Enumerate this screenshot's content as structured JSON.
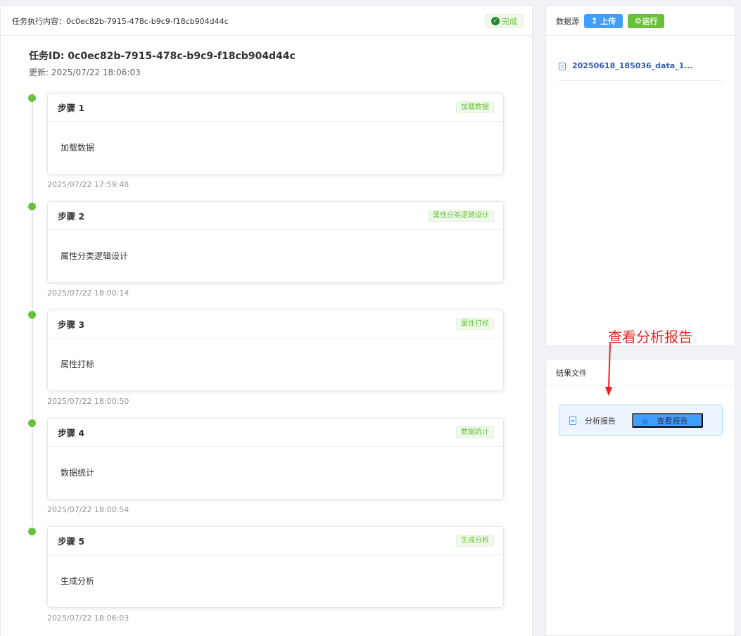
{
  "left": {
    "header_title": "任务执行内容：0c0ec82b-7915-478c-b9c9-f18cb904d44c",
    "status": "完成",
    "task_id": "任务ID: 0c0ec82b-7915-478c-b9c9-f18cb904d44c",
    "updated": "更新: 2025/07/22 18:06:03"
  },
  "steps": [
    {
      "title": "步骤 1",
      "tag": "加载数据",
      "content": "加载数据",
      "time": "2025/07/22 17:59:48"
    },
    {
      "title": "步骤 2",
      "tag": "属性分类逻辑设计",
      "content": "属性分类逻辑设计",
      "time": "2025/07/22 18:00:14"
    },
    {
      "title": "步骤 3",
      "tag": "属性打标",
      "content": "属性打标",
      "time": "2025/07/22 18:00:50"
    },
    {
      "title": "步骤 4",
      "tag": "数据统计",
      "content": "数据统计",
      "time": "2025/07/22 18:00:54"
    },
    {
      "title": "步骤 5",
      "tag": "生成分析",
      "content": "生成分析",
      "time": "2025/07/22 18:06:03"
    }
  ],
  "datasource": {
    "label": "数据源",
    "upload_label": "上传",
    "upload_icon": "↥",
    "run_label": "运行",
    "run_icon": "⊙",
    "file_name": "20250618_185036_data_1..."
  },
  "results": {
    "label": "结果文件",
    "report_name": "分析报告",
    "view_label": "查看报告"
  },
  "annotation": {
    "text": "查看分析报告"
  },
  "colors": {
    "accent": "#409eff",
    "success": "#67c23a",
    "annotation": "#e8231f"
  }
}
